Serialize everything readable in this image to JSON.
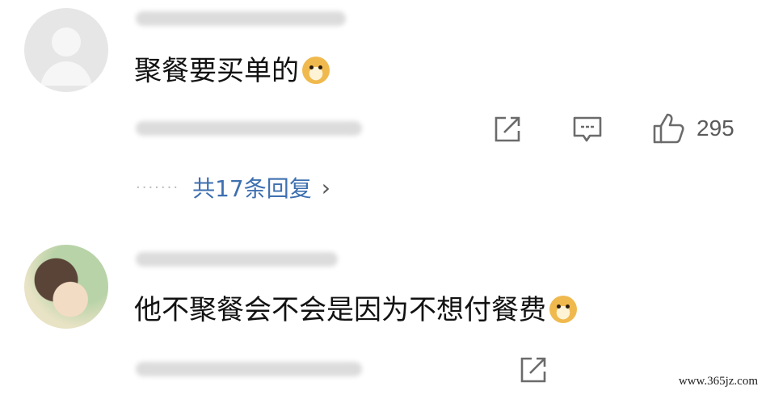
{
  "comments": [
    {
      "text": "聚餐要买单的",
      "emoji": "doge-emoji",
      "actions": {
        "share_icon": "share-icon",
        "reply_icon": "comment-icon",
        "like_icon": "thumbs-up-icon",
        "like_count": "295"
      },
      "replies": {
        "label": "共17条回复",
        "chevron": "›"
      }
    },
    {
      "text": "他不聚餐会不会是因为不想付餐费",
      "emoji": "doge-emoji",
      "actions": {
        "share_icon": "share-icon"
      }
    }
  ],
  "watermark": "www.365jz.com"
}
